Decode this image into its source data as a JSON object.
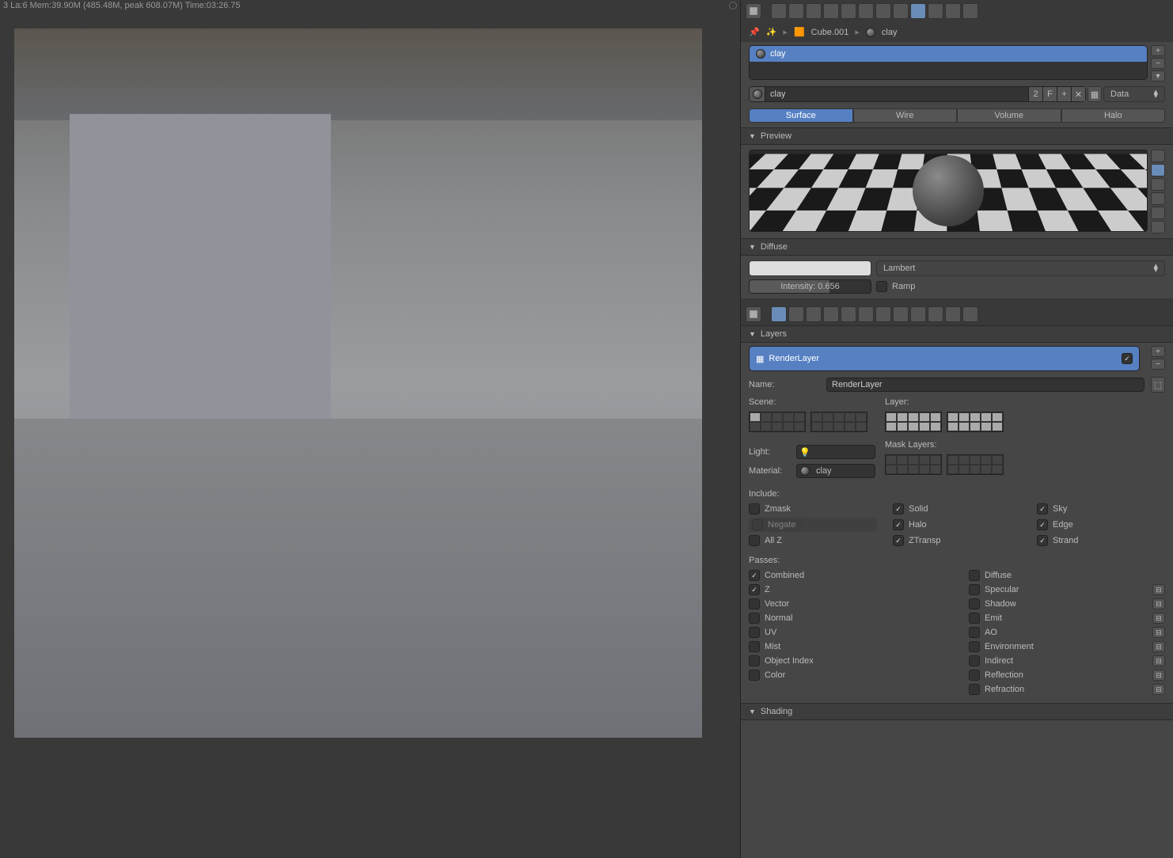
{
  "header": {
    "stats": "3 La:6 Mem:39.90M (485.48M, peak 608.07M) Time:03:26.75"
  },
  "breadcrumb": {
    "object": "Cube.001",
    "material": "clay"
  },
  "material": {
    "list_item": "clay",
    "name": "clay",
    "users": "2",
    "link_mode": "Data",
    "tabs": {
      "surface": "Surface",
      "wire": "Wire",
      "volume": "Volume",
      "halo": "Halo"
    },
    "preview_label": "Preview",
    "diffuse": {
      "label": "Diffuse",
      "shader": "Lambert",
      "intensity_label": "Intensity: 0.656",
      "ramp_label": "Ramp"
    }
  },
  "layers": {
    "header": "Layers",
    "item": "RenderLayer",
    "name_label": "Name:",
    "name_value": "RenderLayer",
    "scene_label": "Scene:",
    "layer_label": "Layer:",
    "mask_label": "Mask Layers:",
    "light_label": "Light:",
    "material_label": "Material:",
    "material_value": "clay",
    "include": {
      "label": "Include:",
      "zmask": "Zmask",
      "solid": "Solid",
      "sky": "Sky",
      "negate": "Negate",
      "halo": "Halo",
      "edge": "Edge",
      "allz": "All Z",
      "ztransp": "ZTransp",
      "strand": "Strand"
    },
    "passes": {
      "label": "Passes:",
      "combined": "Combined",
      "diffuse": "Diffuse",
      "z": "Z",
      "specular": "Specular",
      "vector": "Vector",
      "shadow": "Shadow",
      "normal": "Normal",
      "emit": "Emit",
      "uv": "UV",
      "ao": "AO",
      "mist": "Mist",
      "environment": "Environment",
      "object_index": "Object Index",
      "indirect": "Indirect",
      "color": "Color",
      "reflection": "Reflection",
      "refraction": "Refraction"
    }
  },
  "shading": {
    "header": "Shading"
  }
}
